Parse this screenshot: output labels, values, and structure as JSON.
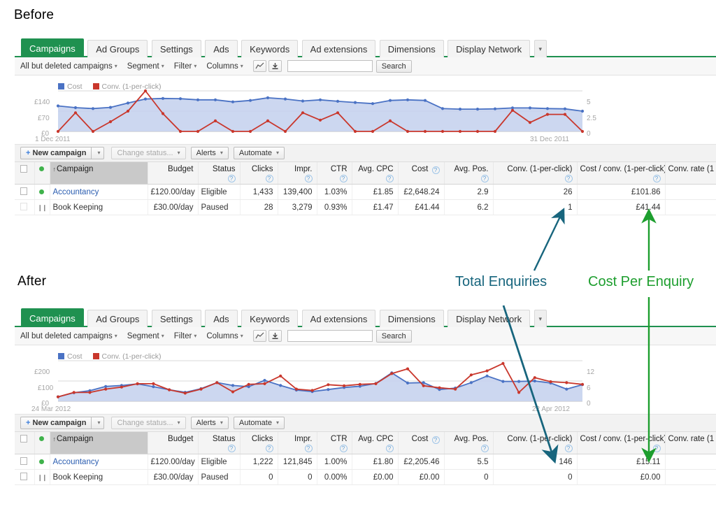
{
  "sections": {
    "before_label": "Before",
    "after_label": "After"
  },
  "annotations": {
    "total_enquiries": {
      "label": "Total Enquiries",
      "color": "#17657d",
      "points_to_before": "26",
      "points_to_after": "146"
    },
    "cost_per_enquiry": {
      "label": "Cost Per Enquiry",
      "color": "#1d9e2e",
      "points_to_before": "£101.86",
      "points_to_after": "£15.11"
    }
  },
  "tabs": [
    {
      "label": "Campaigns",
      "active": true
    },
    {
      "label": "Ad Groups",
      "active": false
    },
    {
      "label": "Settings",
      "active": false
    },
    {
      "label": "Ads",
      "active": false
    },
    {
      "label": "Keywords",
      "active": false
    },
    {
      "label": "Ad extensions",
      "active": false
    },
    {
      "label": "Dimensions",
      "active": false
    },
    {
      "label": "Display Network",
      "active": false
    }
  ],
  "tab_more_caret": "▾",
  "filterbar": {
    "scope": "All but deleted campaigns",
    "segment": "Segment",
    "filter": "Filter",
    "columns": "Columns",
    "chart_icon": "chart-icon",
    "download_icon": "download-icon",
    "search_value": "",
    "search_placeholder": "",
    "search_button": "Search",
    "caret": "▾"
  },
  "actionbar": {
    "new_campaign": "New campaign",
    "plus": "+",
    "change_status": "Change status...",
    "alerts": "Alerts",
    "automate": "Automate",
    "caret": "▾"
  },
  "table": {
    "columns": [
      {
        "key": "checkbox",
        "label": "",
        "help": false
      },
      {
        "key": "status_dot",
        "label": "",
        "help": false
      },
      {
        "key": "campaign",
        "label": "Campaign",
        "help": false,
        "sorted": true,
        "sort_arrow": "↑"
      },
      {
        "key": "budget",
        "label": "Budget",
        "help": false
      },
      {
        "key": "status",
        "label": "Status",
        "help": true
      },
      {
        "key": "clicks",
        "label": "Clicks",
        "help": true
      },
      {
        "key": "impr",
        "label": "Impr.",
        "help": true
      },
      {
        "key": "ctr",
        "label": "CTR",
        "help": true
      },
      {
        "key": "avg_cpc",
        "label": "Avg. CPC",
        "help": true
      },
      {
        "key": "cost",
        "label": "Cost",
        "help": true,
        "inline_help": true
      },
      {
        "key": "avg_pos",
        "label": "Avg. Pos.",
        "help": true
      },
      {
        "key": "conv",
        "label": "Conv. (1-per-click)",
        "help": true
      },
      {
        "key": "cost_conv",
        "label": "Cost / conv. (1-per-click)",
        "help": true
      },
      {
        "key": "conv_rate",
        "label": "Conv. rate (1",
        "help": false
      }
    ],
    "help_glyph": "?"
  },
  "panel_before": {
    "chart": {
      "legend": [
        {
          "label": "Cost",
          "color": "#4a72c4"
        },
        {
          "label": "Conv. (1-per-click)",
          "color": "#c9372c"
        }
      ],
      "y_left_ticks": [
        "£140",
        "£70",
        "£0"
      ],
      "y_right_ticks": [
        "5",
        "2.5",
        "0"
      ],
      "x_start": "1 Dec 2011",
      "x_end": "31 Dec 2011"
    },
    "rows": [
      {
        "checkbox": "",
        "status_dot": "active",
        "campaign": "Accountancy",
        "budget": "£120.00/day",
        "status": "Eligible",
        "clicks": "1,433",
        "impr": "139,400",
        "ctr": "1.03%",
        "avg_cpc": "£1.85",
        "cost": "£2,648.24",
        "avg_pos": "2.9",
        "conv": "26",
        "cost_conv": "£101.86",
        "conv_rate": ""
      },
      {
        "checkbox": "",
        "status_dot": "paused",
        "campaign": "Book Keeping",
        "budget": "£30.00/day",
        "status": "Paused",
        "clicks": "28",
        "impr": "3,279",
        "ctr": "0.93%",
        "avg_cpc": "£1.47",
        "cost": "£41.44",
        "avg_pos": "6.2",
        "conv": "1",
        "cost_conv": "£41.44",
        "conv_rate": ""
      }
    ]
  },
  "panel_after": {
    "chart": {
      "legend": [
        {
          "label": "Cost",
          "color": "#4a72c4"
        },
        {
          "label": "Conv. (1-per-click)",
          "color": "#c9372c"
        }
      ],
      "y_left_ticks": [
        "£200",
        "£100",
        "£0"
      ],
      "y_right_ticks": [
        "12",
        "6",
        "0"
      ],
      "x_start": "24 Mar 2012",
      "x_end": "22 Apr 2012"
    },
    "rows": [
      {
        "checkbox": "",
        "status_dot": "active",
        "campaign": "Accountancy",
        "budget": "£120.00/day",
        "status": "Eligible",
        "clicks": "1,222",
        "impr": "121,845",
        "ctr": "1.00%",
        "avg_cpc": "£1.80",
        "cost": "£2,205.46",
        "avg_pos": "5.5",
        "conv": "146",
        "cost_conv": "£15.11",
        "conv_rate": ""
      },
      {
        "checkbox": "",
        "status_dot": "paused",
        "campaign": "Book Keeping",
        "budget": "£30.00/day",
        "status": "Paused",
        "clicks": "0",
        "impr": "0",
        "ctr": "0.00%",
        "avg_cpc": "£0.00",
        "cost": "£0.00",
        "avg_pos": "0",
        "conv": "0",
        "cost_conv": "£0.00",
        "conv_rate": ""
      }
    ]
  },
  "chart_data": [
    {
      "id": "before",
      "type": "line",
      "title": "Before",
      "xlabel": "",
      "ylabel": "Cost (£)",
      "x_start": "1 Dec 2011",
      "x_end": "31 Dec 2011",
      "ylim": [
        0,
        140
      ],
      "y2lim": [
        0,
        5
      ],
      "y_ticks": [
        0,
        70,
        140
      ],
      "y2_ticks": [
        0,
        2.5,
        5
      ],
      "legend_position": "top-left",
      "grid": true,
      "series": [
        {
          "name": "Cost",
          "color": "#4a72c4",
          "axis": "left",
          "filled": true,
          "values": [
            88,
            82,
            79,
            83,
            98,
            112,
            114,
            113,
            109,
            109,
            102,
            107,
            116,
            112,
            105,
            109,
            104,
            100,
            96,
            107,
            109,
            107,
            79,
            77,
            77,
            78,
            81,
            81,
            79,
            78,
            70
          ]
        },
        {
          "name": "Conv. (1-per-click)",
          "color": "#c9372c",
          "axis": "right",
          "filled": false,
          "values": [
            0,
            2.3,
            0,
            1.2,
            2.5,
            5,
            2.2,
            0,
            0,
            1.3,
            0,
            0,
            1.3,
            0,
            2.3,
            1.4,
            2.3,
            0,
            0,
            1.3,
            0,
            0,
            0,
            0,
            0,
            0,
            2.6,
            1.1,
            2.1,
            2.1,
            0
          ]
        }
      ]
    },
    {
      "id": "after",
      "type": "line",
      "title": "After",
      "xlabel": "",
      "ylabel": "Cost (£)",
      "x_start": "24 Mar 2012",
      "x_end": "22 Apr 2012",
      "ylim": [
        0,
        200
      ],
      "y2lim": [
        0,
        12
      ],
      "y_ticks": [
        0,
        100,
        200
      ],
      "y2_ticks": [
        0,
        6,
        12
      ],
      "legend_position": "top-left",
      "grid": true,
      "series": [
        {
          "name": "Cost",
          "color": "#4a72c4",
          "axis": "left",
          "filled": true,
          "values": [
            22,
            42,
            52,
            73,
            78,
            86,
            72,
            57,
            44,
            62,
            92,
            78,
            72,
            103,
            78,
            55,
            48,
            58,
            68,
            74,
            88,
            140,
            90,
            92,
            58,
            65,
            92,
            125,
            98,
            98,
            100,
            90,
            60,
            82
          ]
        },
        {
          "name": "Conv. (1-per-click)",
          "color": "#c9372c",
          "axis": "right",
          "filled": false,
          "values": [
            1.3,
            2.6,
            2.6,
            3.6,
            4.2,
            5.2,
            5.2,
            3.4,
            2.4,
            3.6,
            5.5,
            2.8,
            5.0,
            5.2,
            7.5,
            3.6,
            3.2,
            4.9,
            4.6,
            5.0,
            5.2,
            8.2,
            9.6,
            4.6,
            4.0,
            3.6,
            7.8,
            9.0,
            11.2,
            2.6,
            7.0,
            5.8,
            5.5,
            5.0
          ]
        }
      ]
    }
  ]
}
